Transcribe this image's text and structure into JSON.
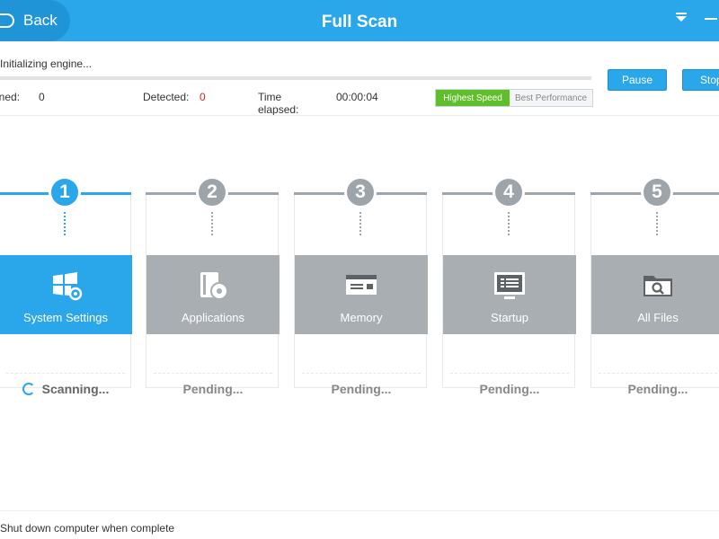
{
  "header": {
    "back_label": "Back",
    "title": "Full Scan"
  },
  "status": {
    "message": "Initializing engine...",
    "progress_percent": 0,
    "scanned_label": "nned:",
    "scanned_value": "0",
    "detected_label": "Detected:",
    "detected_value": "0",
    "time_label": "Time elapsed:",
    "time_value": "00:00:04"
  },
  "speed_modes": {
    "selected": "Highest Speed",
    "options": [
      "Highest Speed",
      "Best Performance"
    ]
  },
  "buttons": {
    "pause": "Pause",
    "stop": "Stop"
  },
  "steps": [
    {
      "number": "1",
      "label": "System Settings",
      "status": "Scanning...",
      "icon": "windows-settings-icon",
      "active": true
    },
    {
      "number": "2",
      "label": "Applications",
      "status": "Pending...",
      "icon": "applications-icon",
      "active": false
    },
    {
      "number": "3",
      "label": "Memory",
      "status": "Pending...",
      "icon": "memory-icon",
      "active": false
    },
    {
      "number": "4",
      "label": "Startup",
      "status": "Pending...",
      "icon": "startup-icon",
      "active": false
    },
    {
      "number": "5",
      "label": "All Files",
      "status": "Pending...",
      "icon": "folder-search-icon",
      "active": false
    }
  ],
  "footer": {
    "shutdown_label": "Shut down computer when complete",
    "shutdown_checked": false
  },
  "colors": {
    "accent": "#2aa7ea",
    "inactive": "#a9aeb2",
    "speed_active": "#5fbf2a",
    "detected_value": "#e02020"
  }
}
